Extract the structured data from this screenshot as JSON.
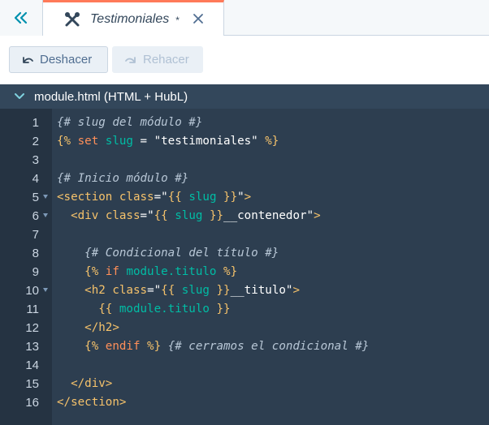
{
  "tabbar": {
    "tab_label": "Testimoniales",
    "dirty_marker": "*",
    "icons": {
      "collapse": "double-chevron-left-icon",
      "tab": "wrench-screwdriver-icon",
      "close": "close-icon"
    }
  },
  "toolbar": {
    "undo_label": "Deshacer",
    "redo_label": "Rehacer"
  },
  "editor": {
    "file_title": "module.html (HTML + HubL)",
    "lines": [
      {
        "n": "1",
        "fold": false,
        "tokens": [
          {
            "t": "cm",
            "v": "{# slug del módulo #}"
          }
        ]
      },
      {
        "n": "2",
        "fold": false,
        "tokens": [
          {
            "t": "tg",
            "v": "{% "
          },
          {
            "t": "kw",
            "v": "set"
          },
          {
            "t": "tx",
            "v": " "
          },
          {
            "t": "vr",
            "v": "slug"
          },
          {
            "t": "tx",
            "v": " = "
          },
          {
            "t": "st",
            "v": "\"testimoniales\""
          },
          {
            "t": "tg",
            "v": " %}"
          }
        ]
      },
      {
        "n": "3",
        "fold": false,
        "tokens": []
      },
      {
        "n": "4",
        "fold": false,
        "tokens": [
          {
            "t": "cm",
            "v": "{# Inicio módulo #}"
          }
        ]
      },
      {
        "n": "5",
        "fold": true,
        "tokens": [
          {
            "t": "tg",
            "v": "<section"
          },
          {
            "t": "tx",
            "v": " "
          },
          {
            "t": "tg",
            "v": "class"
          },
          {
            "t": "tx",
            "v": "=\""
          },
          {
            "t": "tg",
            "v": "{{ "
          },
          {
            "t": "vr",
            "v": "slug"
          },
          {
            "t": "tg",
            "v": " }}"
          },
          {
            "t": "tx",
            "v": "\""
          },
          {
            "t": "tg",
            "v": ">"
          }
        ]
      },
      {
        "n": "6",
        "fold": true,
        "tokens": [
          {
            "t": "tx",
            "v": "  "
          },
          {
            "t": "tg",
            "v": "<div"
          },
          {
            "t": "tx",
            "v": " "
          },
          {
            "t": "tg",
            "v": "class"
          },
          {
            "t": "tx",
            "v": "=\""
          },
          {
            "t": "tg",
            "v": "{{ "
          },
          {
            "t": "vr",
            "v": "slug"
          },
          {
            "t": "tg",
            "v": " }}"
          },
          {
            "t": "tx",
            "v": "__contenedor\""
          },
          {
            "t": "tg",
            "v": ">"
          }
        ]
      },
      {
        "n": "7",
        "fold": false,
        "tokens": []
      },
      {
        "n": "8",
        "fold": false,
        "tokens": [
          {
            "t": "tx",
            "v": "    "
          },
          {
            "t": "cm",
            "v": "{# Condicional del título #}"
          }
        ]
      },
      {
        "n": "9",
        "fold": false,
        "tokens": [
          {
            "t": "tx",
            "v": "    "
          },
          {
            "t": "tg",
            "v": "{% "
          },
          {
            "t": "kw",
            "v": "if"
          },
          {
            "t": "tx",
            "v": " "
          },
          {
            "t": "vr",
            "v": "module.titulo"
          },
          {
            "t": "tg",
            "v": " %}"
          }
        ]
      },
      {
        "n": "10",
        "fold": true,
        "tokens": [
          {
            "t": "tx",
            "v": "    "
          },
          {
            "t": "tg",
            "v": "<h2"
          },
          {
            "t": "tx",
            "v": " "
          },
          {
            "t": "tg",
            "v": "class"
          },
          {
            "t": "tx",
            "v": "=\""
          },
          {
            "t": "tg",
            "v": "{{ "
          },
          {
            "t": "vr",
            "v": "slug"
          },
          {
            "t": "tg",
            "v": " }}"
          },
          {
            "t": "tx",
            "v": "__titulo\""
          },
          {
            "t": "tg",
            "v": ">"
          }
        ]
      },
      {
        "n": "11",
        "fold": false,
        "tokens": [
          {
            "t": "tx",
            "v": "      "
          },
          {
            "t": "tg",
            "v": "{{ "
          },
          {
            "t": "vr",
            "v": "module.titulo"
          },
          {
            "t": "tg",
            "v": " }}"
          }
        ]
      },
      {
        "n": "12",
        "fold": false,
        "tokens": [
          {
            "t": "tx",
            "v": "    "
          },
          {
            "t": "tg",
            "v": "</h2>"
          }
        ]
      },
      {
        "n": "13",
        "fold": false,
        "tokens": [
          {
            "t": "tx",
            "v": "    "
          },
          {
            "t": "tg",
            "v": "{% "
          },
          {
            "t": "kw",
            "v": "endif"
          },
          {
            "t": "tg",
            "v": " %}"
          },
          {
            "t": "tx",
            "v": " "
          },
          {
            "t": "cm",
            "v": "{# cerramos el condicional #}"
          }
        ]
      },
      {
        "n": "14",
        "fold": false,
        "tokens": []
      },
      {
        "n": "15",
        "fold": false,
        "tokens": [
          {
            "t": "tx",
            "v": "  "
          },
          {
            "t": "tg",
            "v": "</div>"
          }
        ]
      },
      {
        "n": "16",
        "fold": false,
        "tokens": [
          {
            "t": "tg",
            "v": "</section>"
          }
        ]
      }
    ]
  },
  "colors": {
    "accent": "#ff7a59",
    "header_bg": "#33475b",
    "editor_bg": "#2d3e50",
    "gutter_bg": "#253342"
  }
}
